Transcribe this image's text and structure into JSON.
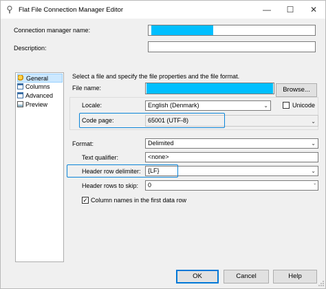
{
  "window": {
    "title": "Flat File Connection Manager Editor",
    "minimize_glyph": "—",
    "maximize_glyph": "☐",
    "close_glyph": "✕"
  },
  "header": {
    "connection_name_label": "Connection manager name:",
    "description_label": "Description:",
    "description_value": ""
  },
  "sidebar": {
    "items": [
      {
        "label": "General",
        "icon": "general-icon"
      },
      {
        "label": "Columns",
        "icon": "document-icon"
      },
      {
        "label": "Advanced",
        "icon": "document-icon"
      },
      {
        "label": "Preview",
        "icon": "preview-icon"
      }
    ],
    "selected": "General"
  },
  "main": {
    "instruction": "Select a file and specify the file properties and the file format.",
    "file_name_label": "File name:",
    "browse_label": "Browse...",
    "locale_label": "Locale:",
    "locale_value": "English (Denmark)",
    "unicode_label": "Unicode",
    "unicode_checked": false,
    "code_page_label": "Code page:",
    "code_page_value": "65001 (UTF-8)",
    "format_label": "Format:",
    "format_value": "Delimited",
    "text_qualifier_label": "Text qualifier:",
    "text_qualifier_value": "<none>",
    "header_row_delimiter_label": "Header row delimiter:",
    "header_row_delimiter_value": "{LF}",
    "header_rows_skip_label": "Header rows to skip:",
    "header_rows_skip_value": "0",
    "column_names_label": "Column names in the first data row",
    "column_names_checked": true,
    "check_glyph": "✓"
  },
  "footer": {
    "ok_label": "OK",
    "cancel_label": "Cancel",
    "help_label": "Help"
  },
  "colors": {
    "redaction": "#00bfff",
    "highlight": "#0a84d8"
  }
}
